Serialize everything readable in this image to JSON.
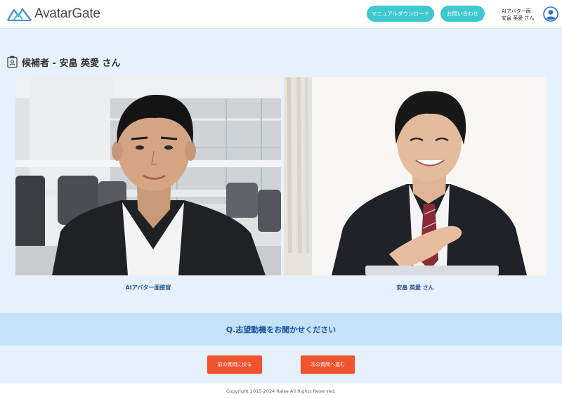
{
  "header": {
    "logo_text": "AvatarGate",
    "manual_download_label": "マニュアルダウンロード",
    "contact_label": "お問い合わせ",
    "user_role": "AIアバター面",
    "user_name": "安畠 英愛 さん"
  },
  "page": {
    "title": "候補者 - 安畠 英愛 さん"
  },
  "videos": {
    "left_label": "AIアバター面接官",
    "right_label": "安畠 英愛 さん"
  },
  "question": {
    "text": "Q.志望動機をお聞かせください"
  },
  "navigation": {
    "prev_label": "前の質問に戻る",
    "next_label": "次の質問へ進む"
  },
  "footer": {
    "copyright": "Copyright 2015-2024 Raise All Rights Reserved."
  },
  "colors": {
    "accent_teal": "#3ec9d0",
    "action_orange": "#f0532d",
    "question_bg": "#c4e3f9",
    "label_blue": "#1f4d8e",
    "page_bg": "#e6f1fc"
  },
  "icons": {
    "logo": "avatargate-logo-mountain-icon",
    "avatar": "user-avatar-icon",
    "title": "clipboard-badge-icon"
  }
}
